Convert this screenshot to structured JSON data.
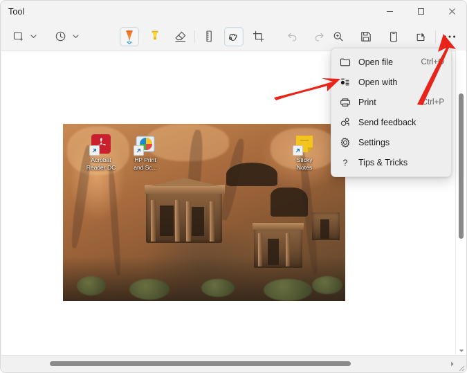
{
  "window": {
    "title": "Tool",
    "controls": {
      "minimize": "minimize",
      "maximize": "maximize",
      "close": "close"
    }
  },
  "toolbar": {
    "items": [
      {
        "name": "new-snip-button",
        "icon": "new-snip-icon",
        "label": "New",
        "has_chevron": true,
        "state": "normal"
      },
      {
        "name": "delay-timer-button",
        "icon": "clock-icon",
        "label": "Delay",
        "has_chevron": true,
        "state": "normal"
      },
      {
        "name": "ballpoint-pen-button",
        "icon": "ballpoint-pen-icon",
        "label": "Ballpoint pen",
        "state": "selected"
      },
      {
        "name": "highlighter-button",
        "icon": "highlighter-icon",
        "label": "Highlighter",
        "state": "normal"
      },
      {
        "name": "eraser-button",
        "icon": "eraser-icon",
        "label": "Eraser",
        "state": "normal"
      },
      {
        "name": "ruler-button",
        "icon": "ruler-icon",
        "label": "Ruler",
        "state": "normal"
      },
      {
        "name": "touch-writing-button",
        "icon": "touch-writing-icon",
        "label": "Touch writing",
        "state": "selected"
      },
      {
        "name": "crop-button",
        "icon": "crop-icon",
        "label": "Crop",
        "state": "normal"
      },
      {
        "name": "undo-button",
        "icon": "undo-icon",
        "label": "Undo",
        "state": "disabled"
      },
      {
        "name": "redo-button",
        "icon": "redo-icon",
        "label": "Redo",
        "state": "disabled"
      },
      {
        "name": "zoom-button",
        "icon": "magnifier-icon",
        "label": "Zoom",
        "state": "normal"
      },
      {
        "name": "save-button",
        "icon": "save-disk-icon",
        "label": "Save as",
        "state": "normal"
      },
      {
        "name": "copy-button",
        "icon": "copy-icon",
        "label": "Copy",
        "state": "normal"
      },
      {
        "name": "share-button",
        "icon": "share-icon",
        "label": "Share",
        "state": "normal"
      },
      {
        "name": "see-more-button",
        "icon": "ellipsis-icon",
        "label": "See more",
        "state": "normal"
      }
    ]
  },
  "menu": {
    "open": true,
    "items": [
      {
        "icon": "folder-icon",
        "label": "Open file",
        "accel": "Ctrl+O"
      },
      {
        "icon": "open-with-icon",
        "label": "Open with",
        "accel": ""
      },
      {
        "icon": "printer-icon",
        "label": "Print",
        "accel": "Ctrl+P"
      },
      {
        "icon": "feedback-icon",
        "label": "Send feedback",
        "accel": ""
      },
      {
        "icon": "gear-icon",
        "label": "Settings",
        "accel": ""
      },
      {
        "icon": "question-mark-icon",
        "label": "Tips & Tricks",
        "accel": ""
      }
    ]
  },
  "canvas": {
    "screenshot_desktop_icons": [
      {
        "name": "acrobat-reader-dc-icon",
        "label": "Acrobat\nReader DC",
        "label_line1": "Acrobat",
        "label_line2": "Reader DC",
        "color": "#c8202e"
      },
      {
        "name": "hp-print-and-scan-icon",
        "label": "HP Print\nand Sc...",
        "label_line1": "HP Print",
        "label_line2": "and Sc...",
        "color": "#0f7bc4"
      },
      {
        "name": "sticky-notes-icon",
        "label": "Sticky\nNotes",
        "label_line1": "Sticky",
        "label_line2": "Notes",
        "color": "#f2c41d"
      }
    ]
  },
  "annotations": {
    "arrow_to_open_with": "red-arrow-pointing-right-at-open-with",
    "arrow_to_see_more": "red-arrow-pointing-up-at-see-more-button",
    "color": "#e8231a"
  },
  "scrollbars": {
    "vertical": "vertical-scrollbar",
    "horizontal": "horizontal-scrollbar"
  }
}
